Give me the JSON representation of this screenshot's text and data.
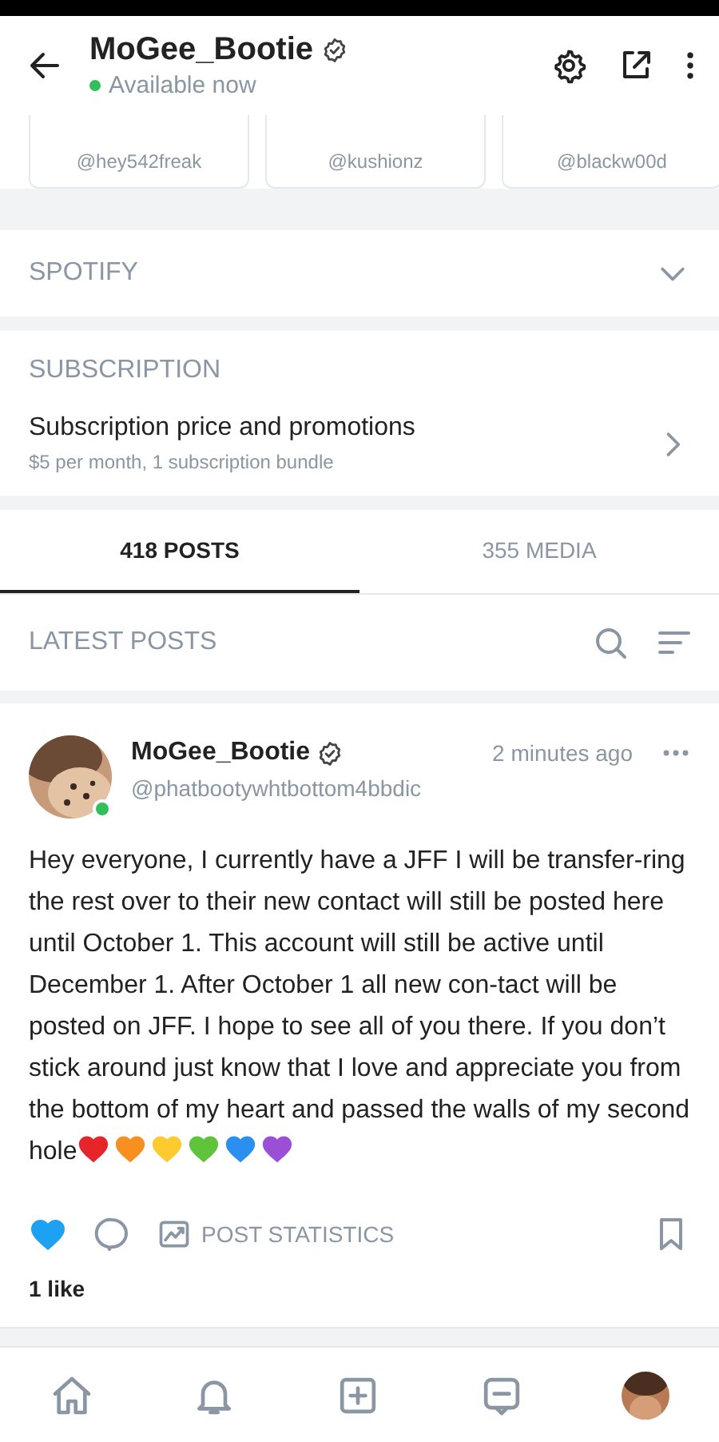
{
  "header": {
    "title": "MoGee_Bootie",
    "verified": true,
    "status": "Available now",
    "online": true
  },
  "suggested": [
    {
      "handle": "@hey542freak"
    },
    {
      "handle": "@kushionz"
    },
    {
      "handle": "@blackw00d"
    }
  ],
  "spotify": {
    "title": "SPOTIFY",
    "expanded": false
  },
  "subscription": {
    "title": "SUBSCRIPTION",
    "item": "Subscription price and promotions",
    "detail": "$5 per month, 1 subscription bundle"
  },
  "tabs": [
    {
      "label": "418 POSTS",
      "selected": true
    },
    {
      "label": "355 MEDIA",
      "selected": false
    }
  ],
  "latest": {
    "title": "LATEST POSTS"
  },
  "post": {
    "author": "MoGee_Bootie",
    "verified": true,
    "handle": "@phatbootywhtbottom4bbdic",
    "time": "2 minutes ago",
    "online": true,
    "text": "Hey everyone, I currently have a JFF I will be transfer-ring the rest over to their new contact will still be posted here until October 1. This account will still be active until December 1. After October 1 all new con-tact will be posted on JFF. I hope to see all of you there. If you don’t stick around just know that I love and appreciate you from the bottom of my heart and passed the walls of my second hole",
    "hearts": [
      {
        "color": "#e5252a"
      },
      {
        "color": "#f7901e"
      },
      {
        "color": "#fdcb2f"
      },
      {
        "color": "#5fc33b"
      },
      {
        "color": "#2b8ff0"
      },
      {
        "color": "#9b4fd6"
      }
    ],
    "liked": true,
    "stats_label": "POST STATISTICS",
    "likes": "1 like"
  },
  "nav": [
    {
      "kind": "home"
    },
    {
      "kind": "bell"
    },
    {
      "kind": "plus"
    },
    {
      "kind": "message"
    },
    {
      "kind": "avatar"
    }
  ]
}
